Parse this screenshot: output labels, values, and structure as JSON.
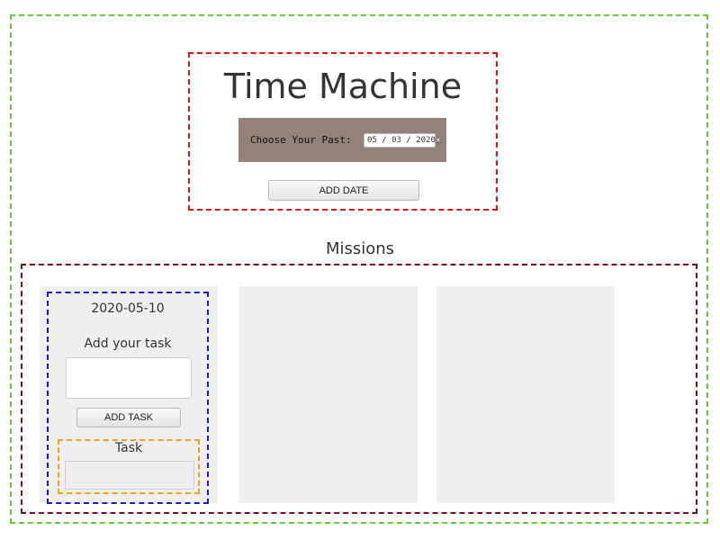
{
  "header": {
    "title": "Time Machine",
    "date_picker": {
      "label": "Choose Your Past:",
      "value": "05 / 03 / 2020",
      "clear_icon": "clear-circle-icon"
    },
    "add_date_label": "ADD DATE"
  },
  "missions": {
    "title": "Missions",
    "cards": [
      {
        "date": "2020-05-10",
        "add_task_label": "Add your task",
        "task_input_value": "",
        "add_task_button": "ADD TASK",
        "task_section_label": "Task",
        "task_value": ""
      },
      {},
      {}
    ]
  },
  "colors": {
    "outer_frame": "#66cc33",
    "header_frame": "#e31010",
    "missions_frame": "#7a0f1a",
    "card_frame": "#1a1acc",
    "task_frame": "#f0a020",
    "date_panel": "#928279",
    "card_background": "#efefef"
  }
}
